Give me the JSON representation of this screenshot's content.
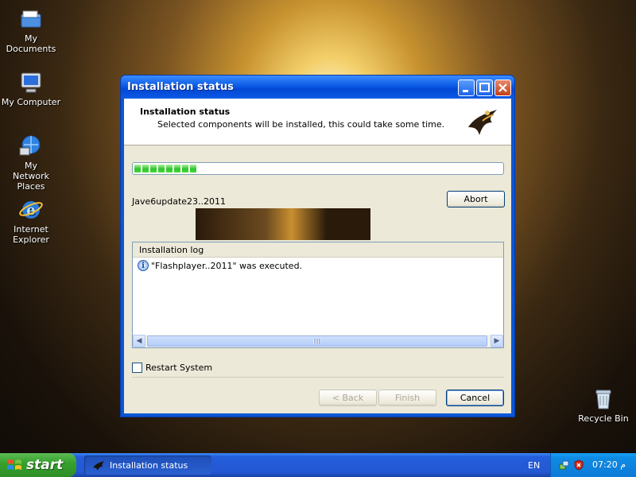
{
  "desktop": {
    "icons": [
      {
        "label": "My Documents",
        "icon": "my-documents-icon"
      },
      {
        "label": "My Computer",
        "icon": "my-computer-icon"
      },
      {
        "label": "My Network Places",
        "icon": "network-places-icon"
      },
      {
        "label": "Internet Explorer",
        "icon": "internet-explorer-icon"
      },
      {
        "label": "Recycle Bin",
        "icon": "recycle-bin-icon"
      }
    ]
  },
  "window": {
    "title": "Installation status",
    "header_title": "Installation status",
    "header_subtitle": "Selected components will be installed, this could take some time.",
    "progress": 0.18,
    "component_label": "Jave6update23..2011",
    "abort_label": "Abort",
    "log": {
      "heading": "Installation log",
      "entries": [
        "\"Flashplayer..2011\" was executed."
      ]
    },
    "restart_label": "Restart System",
    "buttons": {
      "back": "< Back",
      "finish": "Finish",
      "cancel": "Cancel"
    }
  },
  "taskbar": {
    "start_label": "start",
    "task_label": "Installation status",
    "language": "EN",
    "clock": "07:20 م"
  }
}
